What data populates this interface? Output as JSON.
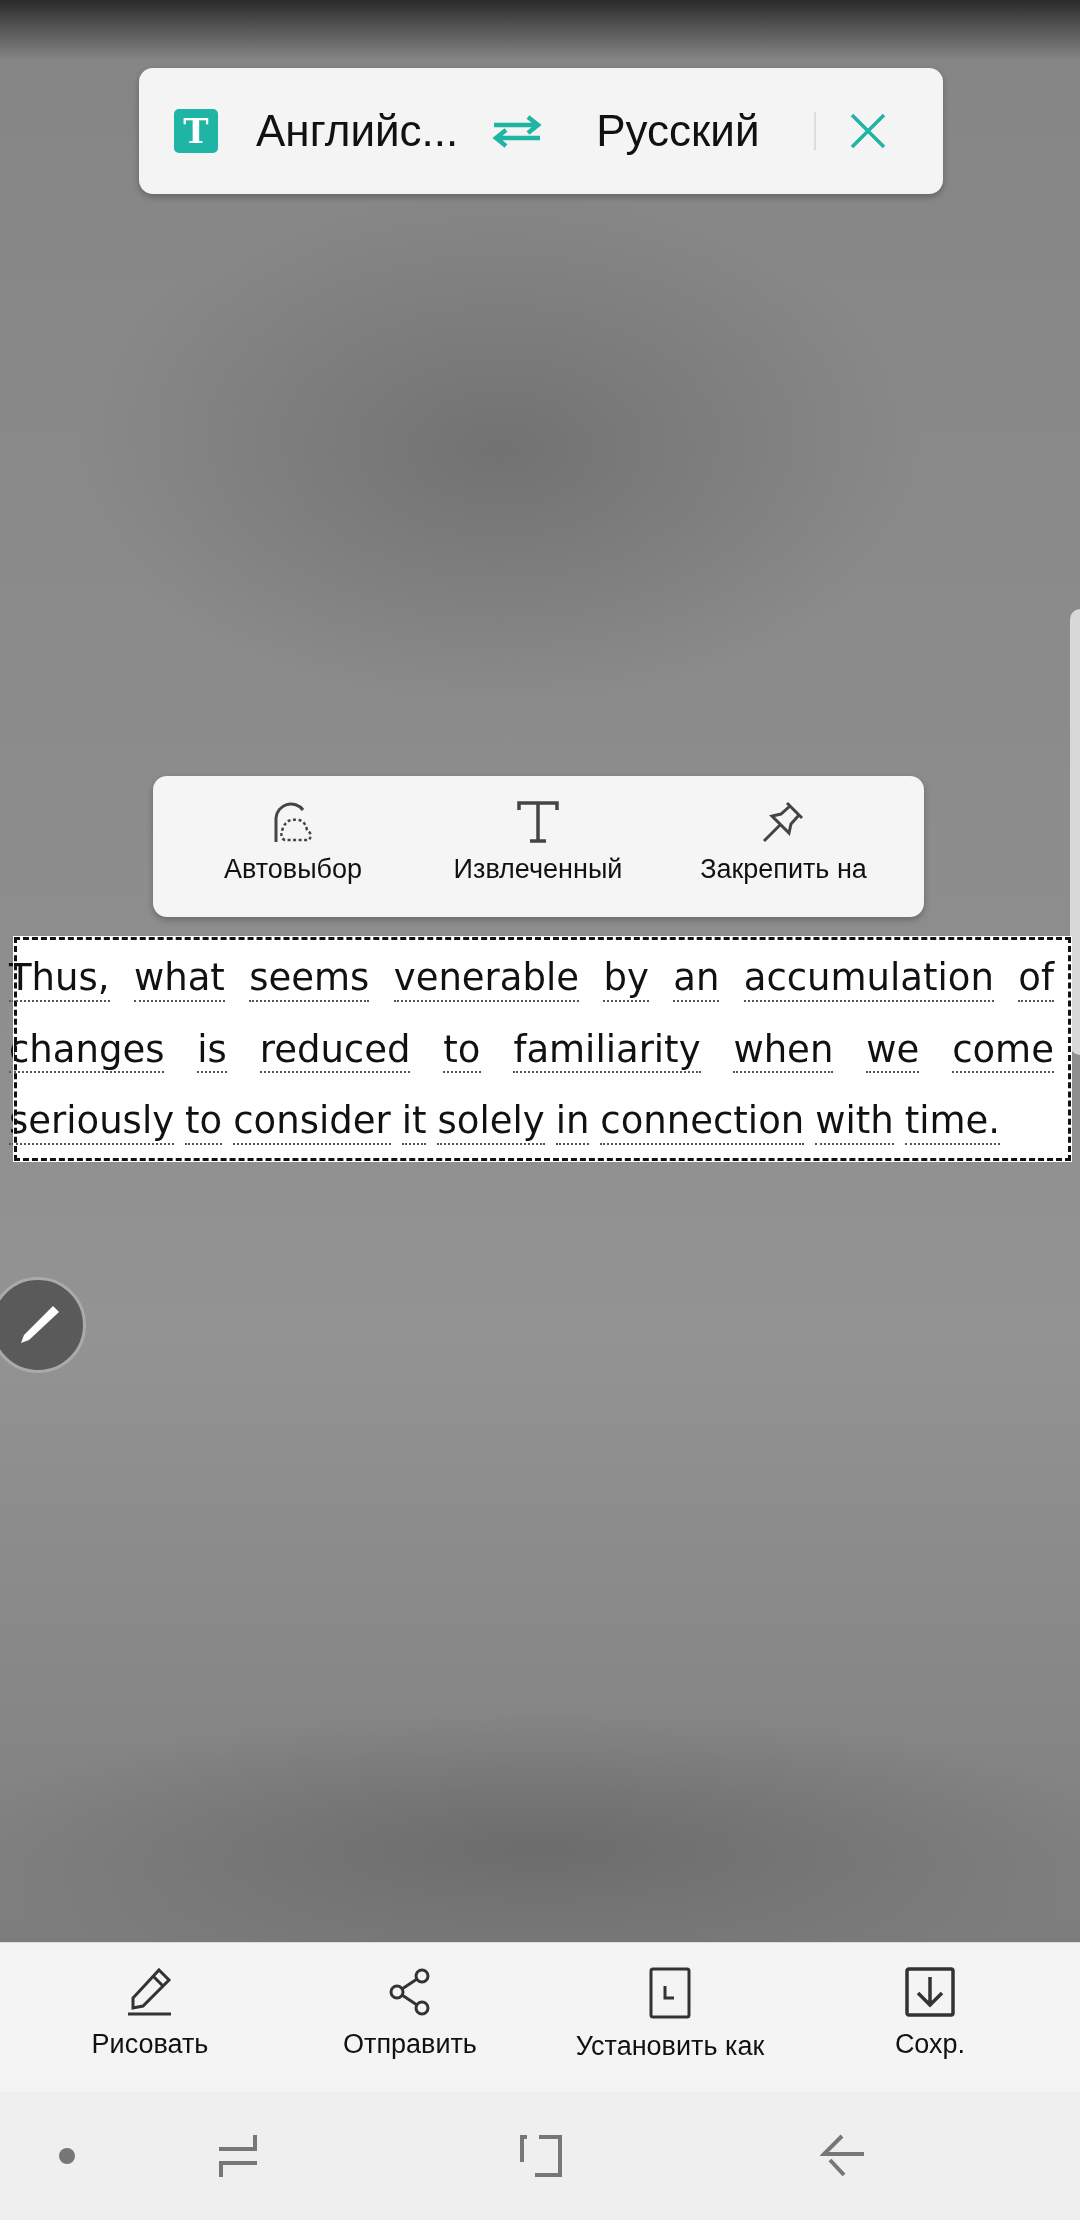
{
  "translate_bar": {
    "app_icon_letter": "T",
    "source_language": "Английс...",
    "target_language": "Русский"
  },
  "selection_menu": [
    {
      "kind": "auto",
      "label": "Автовыбор"
    },
    {
      "kind": "extract",
      "label": "Извлеченный"
    },
    {
      "kind": "pin",
      "label": "Закрепить на"
    }
  ],
  "selected_text": {
    "lines": [
      {
        "words": [
          "Thus,",
          "what",
          "seems",
          "venerable",
          "by",
          "an",
          "accumulation",
          "of"
        ]
      },
      {
        "words": [
          "changes",
          "is",
          "reduced",
          "to",
          "familiarity",
          "when",
          "we",
          "come"
        ]
      },
      {
        "words": [
          "seriously",
          "to",
          "consider",
          "it",
          "solely",
          "in",
          "connection",
          "with",
          "time."
        ]
      }
    ]
  },
  "toolbar": [
    {
      "kind": "draw",
      "label": "Рисовать"
    },
    {
      "kind": "share",
      "label": "Отправить"
    },
    {
      "kind": "set_as",
      "label": "Установить как"
    },
    {
      "kind": "save",
      "label": "Сохр."
    }
  ]
}
